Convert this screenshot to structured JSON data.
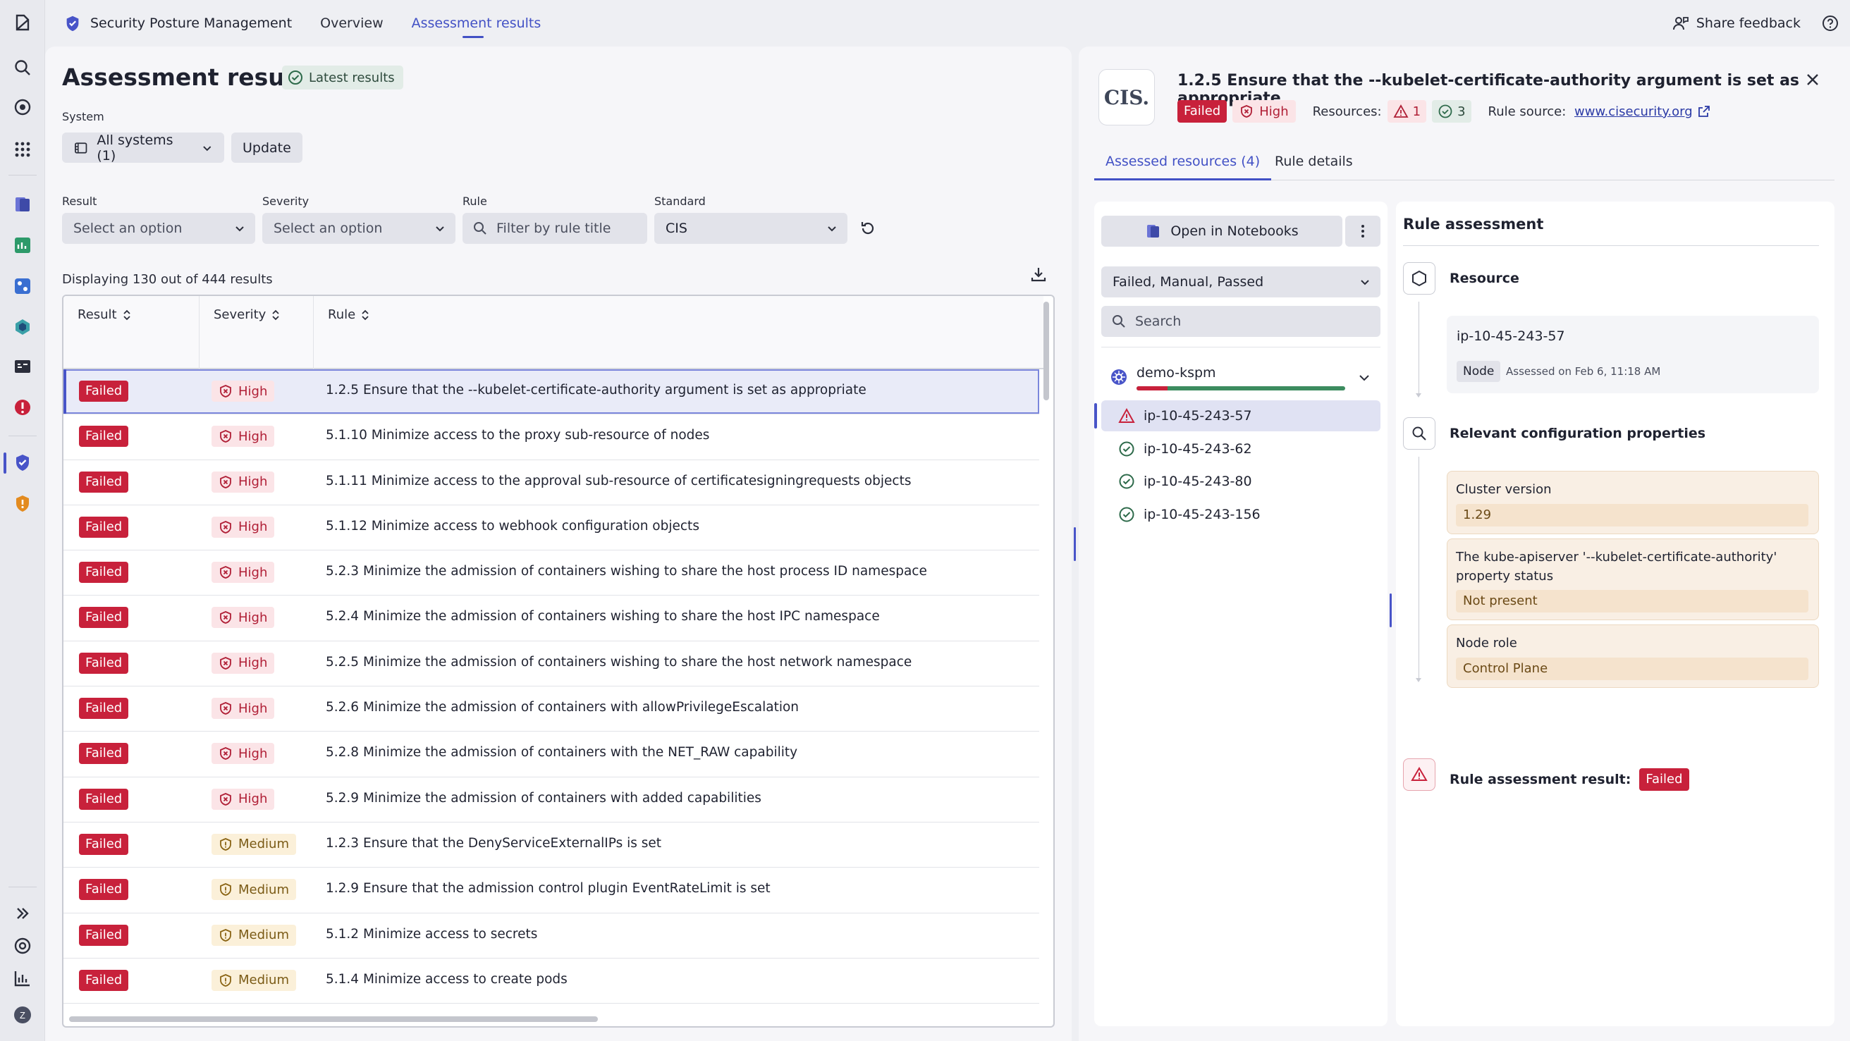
{
  "app": {
    "name": "Security Posture Management",
    "nav": [
      "Overview",
      "Assessment results"
    ],
    "share_feedback": "Share feedback"
  },
  "colors": {
    "accent": "#4251c5",
    "failed": "#c8213b",
    "high_bg": "#fbe4e7",
    "medium_bg": "#fbf0d9",
    "passed": "#3c8c5f"
  },
  "page": {
    "title": "Assessment results",
    "latest_badge": "Latest results",
    "system_label": "System",
    "system_value": "All systems (1)",
    "update_button": "Update"
  },
  "filters": {
    "result_label": "Result",
    "result_placeholder": "Select an option",
    "severity_label": "Severity",
    "severity_placeholder": "Select an option",
    "rule_label": "Rule",
    "rule_placeholder": "Filter by rule title",
    "standard_label": "Standard",
    "standard_value": "CIS"
  },
  "table": {
    "displaying": "Displaying 130 out of 444 results",
    "columns": [
      "Result",
      "Severity",
      "Rule"
    ],
    "rows": [
      {
        "result": "Failed",
        "severity": "High",
        "rule": "1.2.5 Ensure that the --kubelet-certificate-authority argument is set as appropriate"
      },
      {
        "result": "Failed",
        "severity": "High",
        "rule": "5.1.10 Minimize access to the proxy sub-resource of nodes"
      },
      {
        "result": "Failed",
        "severity": "High",
        "rule": "5.1.11 Minimize access to the approval sub-resource of certificatesigningrequests objects"
      },
      {
        "result": "Failed",
        "severity": "High",
        "rule": "5.1.12 Minimize access to webhook configuration objects"
      },
      {
        "result": "Failed",
        "severity": "High",
        "rule": "5.2.3 Minimize the admission of containers wishing to share the host process ID namespace"
      },
      {
        "result": "Failed",
        "severity": "High",
        "rule": "5.2.4 Minimize the admission of containers wishing to share the host IPC namespace"
      },
      {
        "result": "Failed",
        "severity": "High",
        "rule": "5.2.5 Minimize the admission of containers wishing to share the host network namespace"
      },
      {
        "result": "Failed",
        "severity": "High",
        "rule": "5.2.6 Minimize the admission of containers with allowPrivilegeEscalation"
      },
      {
        "result": "Failed",
        "severity": "High",
        "rule": "5.2.8 Minimize the admission of containers with the NET_RAW capability"
      },
      {
        "result": "Failed",
        "severity": "High",
        "rule": "5.2.9 Minimize the admission of containers with added capabilities"
      },
      {
        "result": "Failed",
        "severity": "Medium",
        "rule": "1.2.3 Ensure that the DenyServiceExternalIPs is set"
      },
      {
        "result": "Failed",
        "severity": "Medium",
        "rule": "1.2.9 Ensure that the admission control plugin EventRateLimit is set"
      },
      {
        "result": "Failed",
        "severity": "Medium",
        "rule": "5.1.2 Minimize access to secrets"
      },
      {
        "result": "Failed",
        "severity": "Medium",
        "rule": "5.1.4 Minimize access to create pods"
      }
    ]
  },
  "detail": {
    "logo_text": "CIS.",
    "title": "1.2.5 Ensure that the --kubelet-certificate-authority argument is set as appropriate",
    "result": "Failed",
    "severity": "High",
    "resources_label": "Resources:",
    "resources_failed": "1",
    "resources_passed": "3",
    "rule_source_label": "Rule source:",
    "rule_source_link": "www.cisecurity.org",
    "tabs": [
      "Assessed resources (4)",
      "Rule details"
    ],
    "open_notebooks": "Open in Notebooks",
    "status_filter": "Failed, Manual, Passed",
    "search_placeholder": "Search",
    "group": {
      "name": "demo-kspm",
      "failed_fraction": 0.15
    },
    "resources": [
      {
        "name": "ip-10-45-243-57",
        "status": "failed"
      },
      {
        "name": "ip-10-45-243-62",
        "status": "passed"
      },
      {
        "name": "ip-10-45-243-80",
        "status": "passed"
      },
      {
        "name": "ip-10-45-243-156",
        "status": "passed"
      }
    ],
    "assessment": {
      "title": "Rule assessment",
      "resource_label": "Resource",
      "resource_name": "ip-10-45-243-57",
      "resource_type": "Node",
      "assessed_on": "Assessed on Feb 6, 11:18 AM",
      "config_label": "Relevant configuration properties",
      "properties": [
        {
          "label": "Cluster version",
          "value": "1.29"
        },
        {
          "label": "The kube-apiserver '--kubelet-certificate-authority' property status",
          "value": "Not present"
        },
        {
          "label": "Node role",
          "value": "Control Plane"
        }
      ],
      "result_label": "Rule assessment result:",
      "result_value": "Failed"
    }
  }
}
